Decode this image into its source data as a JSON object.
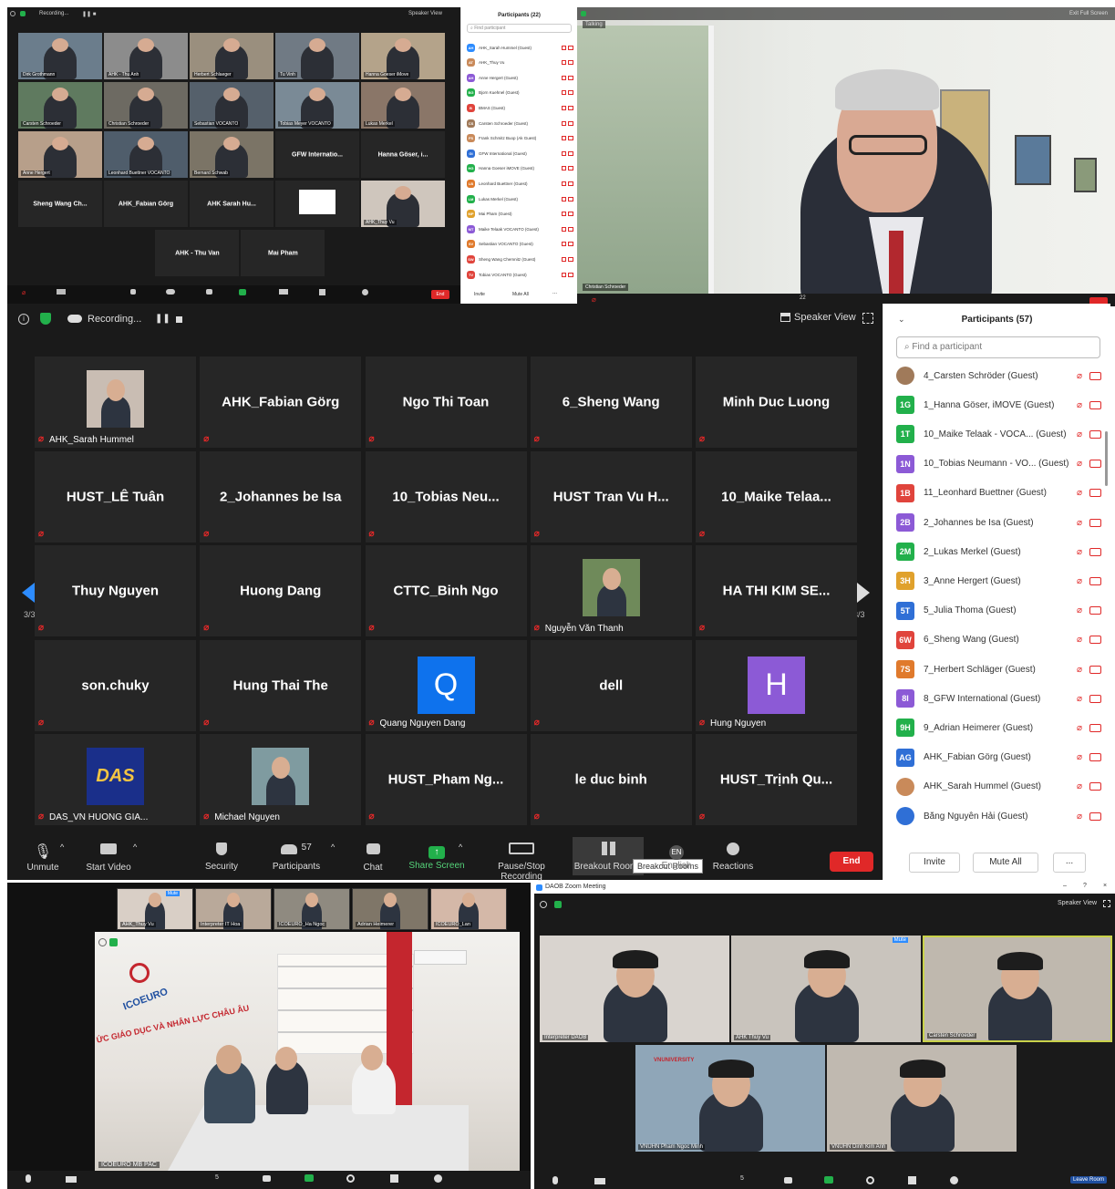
{
  "panel1": {
    "recording": "Recording...",
    "speaker_view": "Speaker View",
    "participants_title": "Participants (22)",
    "find_placeholder": "Find participant",
    "tiles": [
      {
        "label": "Dirk Grothmann",
        "kind": "photo",
        "bg": "#6b7d8c"
      },
      {
        "label": "AHK - Thu Anh",
        "kind": "photo",
        "bg": "#8c8c8c"
      },
      {
        "label": "Herbert Schlaeger",
        "kind": "photo",
        "bg": "#9a8f7e"
      },
      {
        "label": "Tu Vinh",
        "kind": "photo",
        "bg": "#707a84"
      },
      {
        "label": "Hanna Goeser iMove",
        "kind": "photo",
        "bg": "#b4a38a"
      },
      {
        "label": "Carsten Schroeder",
        "kind": "photo",
        "bg": "#5f7a5f"
      },
      {
        "label": "Christian Schroeder",
        "kind": "photo",
        "bg": "#6d6a62"
      },
      {
        "label": "Sebastian VOCANTO",
        "kind": "photo",
        "bg": "#55606b"
      },
      {
        "label": "Tobias Meyer VOCANTO",
        "kind": "photo",
        "bg": "#7a8a96"
      },
      {
        "label": "Lukas Merkel",
        "kind": "photo",
        "bg": "#8a7668"
      },
      {
        "label": "Anne Hergert",
        "kind": "photo",
        "bg": "#b79f8a"
      },
      {
        "label": "Leonhard Buettner VOCANTO",
        "kind": "photo",
        "bg": "#4f5d6b"
      },
      {
        "label": "Bernard Schwab",
        "kind": "photo",
        "bg": "#7b7466"
      },
      {
        "label": "GFW Internatio...",
        "kind": "name"
      },
      {
        "label": "Hanna Göser, i...",
        "kind": "name"
      },
      {
        "label": "Sheng Wang Ch...",
        "kind": "name"
      },
      {
        "label": "AHK_Fabian Görg",
        "kind": "name"
      },
      {
        "label": "AHK Sarah Hu...",
        "kind": "name"
      },
      {
        "label": "AHK logo",
        "kind": "logo"
      },
      {
        "label": "AHK_Thuy Vu",
        "kind": "photo",
        "bg": "#cfc6bd"
      },
      {
        "label": "AHK - Thu Van",
        "kind": "name"
      },
      {
        "label": "Mai Pham",
        "kind": "name"
      }
    ],
    "participants": [
      {
        "initials": "AH",
        "color": "#2d8cff",
        "name": "AHK_Sarah Hummel (Guest)"
      },
      {
        "initials": "AT",
        "color": "#c98a5a",
        "name": "AHK_Thuy Vu"
      },
      {
        "initials": "AH",
        "color": "#8c5ad6",
        "name": "Anne Hergert (Guest)"
      },
      {
        "initials": "BG",
        "color": "#22b04b",
        "name": "Bjorn Kuehnel (Guest)"
      },
      {
        "initials": "B",
        "color": "#e0443c",
        "name": "BMAS (Guest)"
      },
      {
        "initials": "CS",
        "color": "#a07a5a",
        "name": "Carsten Schroeder (Guest)"
      },
      {
        "initials": "FS",
        "color": "#c98a5a",
        "name": "Frank Schmitz Buop (Ak Guest)"
      },
      {
        "initials": "GI",
        "color": "#2f6fd6",
        "name": "GFW International (Guest)"
      },
      {
        "initials": "HG",
        "color": "#22b04b",
        "name": "Hanna Goeser iMOVE (Guest)"
      },
      {
        "initials": "LB",
        "color": "#e07a2c",
        "name": "Leonhard Buettner (Guest)"
      },
      {
        "initials": "LM",
        "color": "#22b04b",
        "name": "Lukas Merkel (Guest)"
      },
      {
        "initials": "MP",
        "color": "#e0a12c",
        "name": "Mai Pham (Guest)"
      },
      {
        "initials": "MT",
        "color": "#8c5ad6",
        "name": "Maike Telaak VOCANTO (Guest)"
      },
      {
        "initials": "SV",
        "color": "#e07a2c",
        "name": "Sebastian VOCANTO (Guest)"
      },
      {
        "initials": "SW",
        "color": "#e0443c",
        "name": "Sheng Wang Chemnitz (Guest)"
      },
      {
        "initials": "TV",
        "color": "#e0443c",
        "name": "Tobias VOCANTO (Guest)"
      }
    ],
    "invite": "Invite",
    "mute_all": "Mute All",
    "more": "..."
  },
  "panel2": {
    "talking": "Talking",
    "exit_full": "Exit Full Screen",
    "name_label": "Christian Schroeder",
    "count": "22"
  },
  "panel3": {
    "recording": "Recording...",
    "speaker_view": "Speaker View",
    "page_left": "3/3",
    "page_right": "3/3",
    "tiles": [
      {
        "name": "",
        "label": "AHK_Sarah Hummel",
        "kind": "photo",
        "bg": "#c9bdb3"
      },
      {
        "name": "AHK_Fabian Görg",
        "label": "",
        "kind": "name"
      },
      {
        "name": "Ngo Thi Toan",
        "label": "",
        "kind": "name"
      },
      {
        "name": "6_Sheng Wang",
        "label": "",
        "kind": "name"
      },
      {
        "name": "Minh Duc Luong",
        "label": "",
        "kind": "name"
      },
      {
        "name": "HUST_LÊ Tuân",
        "label": "",
        "kind": "name"
      },
      {
        "name": "2_Johannes be Isa",
        "label": "",
        "kind": "name"
      },
      {
        "name": "10_Tobias  Neu...",
        "label": "",
        "kind": "name"
      },
      {
        "name": "HUST Tran Vu H...",
        "label": "",
        "kind": "name"
      },
      {
        "name": "10_Maike  Telaa...",
        "label": "",
        "kind": "name"
      },
      {
        "name": "Thuy Nguyen",
        "label": "",
        "kind": "name"
      },
      {
        "name": "Huong Dang",
        "label": "",
        "kind": "name"
      },
      {
        "name": "CTTC_Binh Ngo",
        "label": "",
        "kind": "name"
      },
      {
        "name": "",
        "label": "Nguyễn Văn Thanh",
        "kind": "photo",
        "bg": "#6f8a5a"
      },
      {
        "name": "HA THI KIM SE...",
        "label": "",
        "kind": "name"
      },
      {
        "name": "son.chuky",
        "label": "",
        "kind": "name"
      },
      {
        "name": "Hung Thai The",
        "label": "",
        "kind": "name"
      },
      {
        "name": "Q",
        "label": "Quang Nguyen Dang",
        "kind": "letter",
        "bg": "#0e72ed"
      },
      {
        "name": "dell",
        "label": "",
        "kind": "name"
      },
      {
        "name": "H",
        "label": "Hung Nguyen",
        "kind": "letter",
        "bg": "#8c5ad6"
      },
      {
        "name": "DAS",
        "label": "DAS_VN HUONG GIA...",
        "kind": "logo"
      },
      {
        "name": "",
        "label": "Michael Nguyen",
        "kind": "photo",
        "bg": "#7f9ba0"
      },
      {
        "name": "HUST_Pham  Ng...",
        "label": "",
        "kind": "name"
      },
      {
        "name": "le duc binh",
        "label": "",
        "kind": "name"
      },
      {
        "name": "HUST_Trịnh  Qu...",
        "label": "",
        "kind": "name"
      }
    ],
    "toolbar": {
      "unmute": "Unmute",
      "start_video": "Start Video",
      "security": "Security",
      "participants": "Participants",
      "participants_count": "57",
      "chat": "Chat",
      "share_screen": "Share Screen",
      "recording": "Pause/Stop Recording",
      "breakout": "Breakout Rooms",
      "breakout_tooltip": "Breakout Rooms",
      "interpretation": "English",
      "lang_badge": "EN",
      "reactions": "Reactions",
      "end": "End"
    },
    "participants_title": "Participants (57)",
    "find_placeholder": "Find a participant",
    "participants": [
      {
        "initials": "",
        "color": "#a07a5a",
        "name": "4_Carsten Schröder (Guest)",
        "photo": true
      },
      {
        "initials": "1G",
        "color": "#22b04b",
        "name": "1_Hanna Göser, iMOVE (Guest)"
      },
      {
        "initials": "1T",
        "color": "#22b04b",
        "name": "10_Maike Telaak - VOCA...  (Guest)"
      },
      {
        "initials": "1N",
        "color": "#8c5ad6",
        "name": "10_Tobias Neumann - VO...  (Guest)"
      },
      {
        "initials": "1B",
        "color": "#e0443c",
        "name": "11_Leonhard Buettner (Guest)"
      },
      {
        "initials": "2B",
        "color": "#8c5ad6",
        "name": "2_Johannes be Isa (Guest)"
      },
      {
        "initials": "2M",
        "color": "#22b04b",
        "name": "2_Lukas Merkel (Guest)"
      },
      {
        "initials": "3H",
        "color": "#e0a12c",
        "name": "3_Anne Hergert (Guest)"
      },
      {
        "initials": "5T",
        "color": "#2f6fd6",
        "name": "5_Julia Thoma (Guest)"
      },
      {
        "initials": "6W",
        "color": "#e0443c",
        "name": "6_Sheng Wang (Guest)"
      },
      {
        "initials": "7S",
        "color": "#e07a2c",
        "name": "7_Herbert Schläger (Guest)"
      },
      {
        "initials": "8I",
        "color": "#8c5ad6",
        "name": "8_GFW International (Guest)"
      },
      {
        "initials": "9H",
        "color": "#22b04b",
        "name": "9_Adrian Heimerer (Guest)"
      },
      {
        "initials": "AG",
        "color": "#2f6fd6",
        "name": "AHK_Fabian Görg (Guest)"
      },
      {
        "initials": "",
        "color": "#c98a5a",
        "name": "AHK_Sarah Hummel (Guest)",
        "photo": true
      },
      {
        "initials": "",
        "color": "#2f6fd6",
        "name": "Bằng Nguyễn Hải (Guest)",
        "photo": true
      }
    ],
    "invite": "Invite",
    "mute_all": "Mute All",
    "more": "..."
  },
  "panel4": {
    "strip": [
      {
        "label": "AHK_Thuy Vu",
        "bg": "#d9cfc6"
      },
      {
        "label": "Interpreter IT Hoa",
        "bg": "#b9a99a"
      },
      {
        "label": "ICOEURO_Ha Ngoc",
        "bg": "#8f8a80"
      },
      {
        "label": "Adrian Heimerer",
        "bg": "#7f7668"
      },
      {
        "label": "ICOEURO_Lan",
        "bg": "#d4b8a8"
      }
    ],
    "mute": "Mute",
    "room_label": "ICOEURO MB PAC",
    "brand": "ICOEURO",
    "banner": "ỨC GIÁO DỤC VÀ NHÂN LỰC CHÂU ÂU",
    "count": "5"
  },
  "panel5": {
    "title": "DAOB Zoom Meeting",
    "speaker_view": "Speaker View",
    "tiles": [
      {
        "label": "Interpreter DAOB",
        "bg": "#d9d4cf"
      },
      {
        "label": "AHK Thuy Vu",
        "bg": "#c9c4bd"
      },
      {
        "label": "Carsten Schroeder",
        "bg": "#bfb8ae"
      },
      {
        "label": "VNUHN Pham Ngoc Minh",
        "bg": "#8fa6b8"
      },
      {
        "label": "VNUHN Dinh Kim Anh",
        "bg": "#c0b9b0"
      }
    ],
    "mute": "Mute",
    "uni": "VNUNIVERSITY",
    "leave": "Leave Room",
    "count": "5",
    "window_min": "–",
    "window_max": "?",
    "window_close": "×"
  }
}
